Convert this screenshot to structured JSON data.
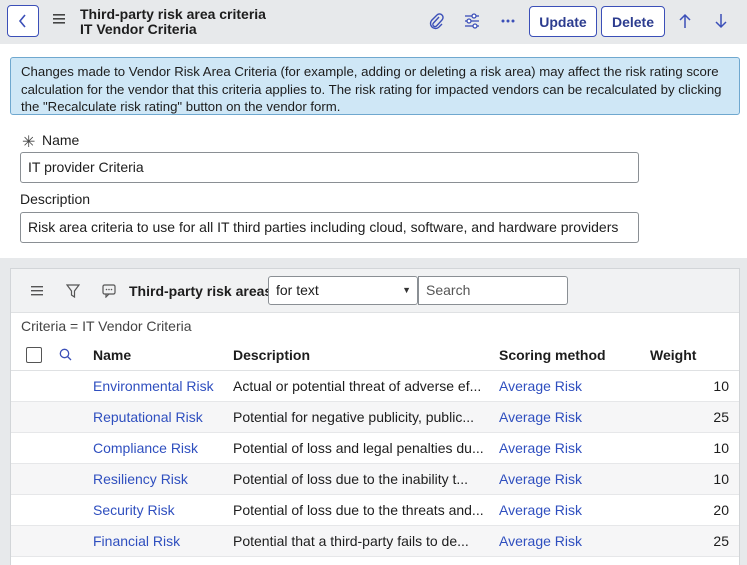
{
  "header": {
    "title": "Third-party risk area criteria",
    "subtitle": "IT Vendor Criteria",
    "update_label": "Update",
    "delete_label": "Delete"
  },
  "banner": {
    "text": "Changes made to Vendor Risk Area Criteria (for example, adding or deleting a risk area) may affect the risk rating score calculation for the vendor that this criteria applies to. The risk rating for impacted vendors can be recalculated by clicking the \"Recalculate risk rating\" button on the vendor form."
  },
  "form": {
    "name_label": "Name",
    "name_value": "IT provider Criteria",
    "description_label": "Description",
    "description_value": "Risk area criteria to use for all IT third parties including cloud, software, and hardware providers"
  },
  "related_list": {
    "title": "Third-party risk areas",
    "filter_select": "for text",
    "search_placeholder": "Search",
    "breadcrumb": "Criteria = IT Vendor Criteria",
    "columns": [
      "Name",
      "Description",
      "Scoring method",
      "Weight"
    ],
    "rows": [
      {
        "name": "Environmental Risk",
        "description": "Actual or potential threat of adverse ef...",
        "scoring": "Average Risk",
        "weight": "10"
      },
      {
        "name": "Reputational Risk",
        "description": "Potential for negative publicity, public...",
        "scoring": "Average Risk",
        "weight": "25"
      },
      {
        "name": "Compliance Risk",
        "description": "Potential of loss and legal penalties du...",
        "scoring": "Average Risk",
        "weight": "10"
      },
      {
        "name": "Resiliency Risk",
        "description": "Potential of loss due to the inability t...",
        "scoring": "Average Risk",
        "weight": "10"
      },
      {
        "name": "Security Risk",
        "description": "Potential of loss due to the threats and...",
        "scoring": "Average Risk",
        "weight": "20"
      },
      {
        "name": "Financial Risk",
        "description": "Potential that a third-party fails to de...",
        "scoring": "Average Risk",
        "weight": "25"
      }
    ]
  },
  "icons": {
    "back": "chevron-left-icon",
    "menu": "hamburger-icon",
    "attach": "paperclip-icon",
    "settings": "sliders-icon",
    "more": "ellipsis-icon",
    "up": "arrow-up-icon",
    "down": "arrow-down-icon",
    "filter": "funnel-icon",
    "chat": "chat-icon",
    "search": "search-icon"
  },
  "colors": {
    "accent": "#3b4fb8",
    "link": "#2f4fbf",
    "banner_bg": "#cfe7f6",
    "header_bg": "#e7e9eb"
  }
}
